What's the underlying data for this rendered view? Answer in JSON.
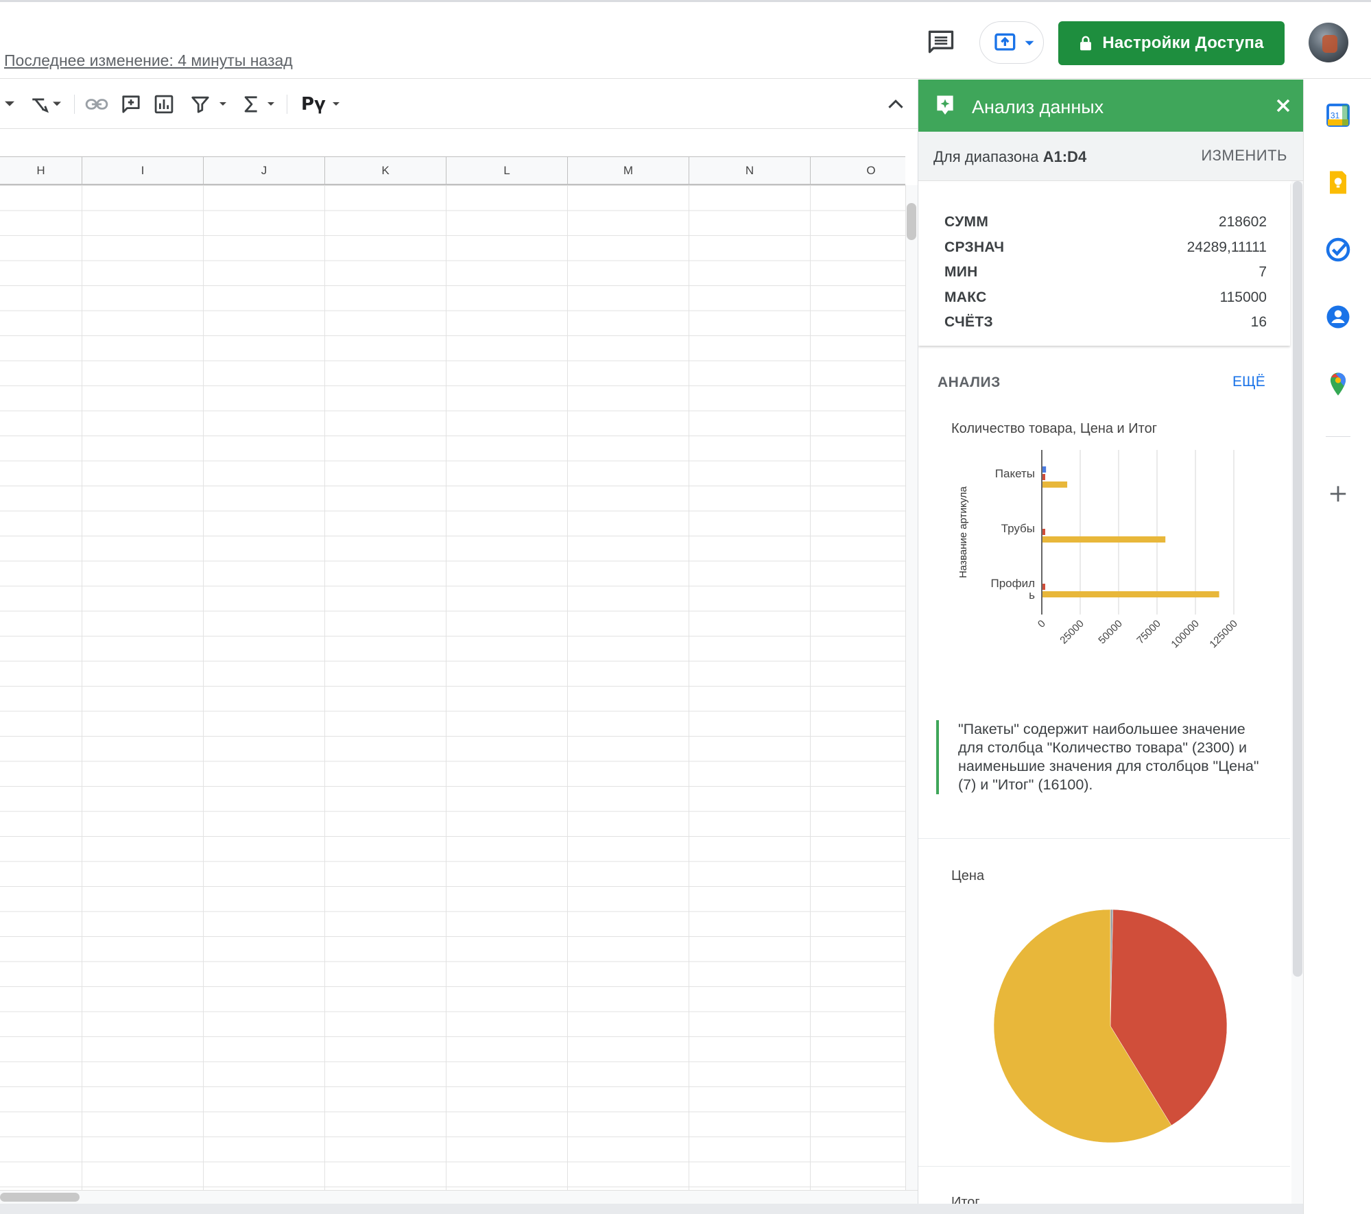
{
  "header": {
    "last_edit": "Последнее изменение: 4 минуты назад",
    "share_label": "Настройки Доступа"
  },
  "toolbar": {
    "script_label": "Рү"
  },
  "columns": [
    "H",
    "I",
    "J",
    "K",
    "L",
    "M",
    "N",
    "O"
  ],
  "panel": {
    "title": "Анализ данных",
    "range_prefix": "Для диапазона ",
    "range_value": "A1:D4",
    "change_label": "ИЗМЕНИТЬ",
    "stats": [
      {
        "name": "СУММ",
        "value": "218602"
      },
      {
        "name": "СРЗНАЧ",
        "value": "24289,11111"
      },
      {
        "name": "МИН",
        "value": "7"
      },
      {
        "name": "МАКС",
        "value": "115000"
      },
      {
        "name": "СЧЁТЗ",
        "value": "16"
      }
    ],
    "analysis_title": "АНАЛИЗ",
    "analysis_more": "ЕЩЁ",
    "insight": "\"Пакеты\" содержит наибольшее значение для столбца \"Количество товара\" (2300) и наименьшие значения для столбцов \"Цена\" (7) и \"Итог\" (16100).",
    "chart3_title": "Итог"
  },
  "colors": {
    "accent_green": "#3fa65a",
    "share_green": "#1e8e3e",
    "series_blue": "#4a7be0",
    "series_red": "#d04e3a",
    "series_yellow": "#e8b73a",
    "link_blue": "#1a73e8"
  },
  "chart_data": [
    {
      "type": "bar",
      "orientation": "horizontal",
      "title": "Количество товара, Цена и Итог",
      "ylabel": "Название артикула",
      "xlabel": "",
      "categories": [
        "Пакеты",
        "Трубы",
        "Профиль"
      ],
      "series": [
        {
          "values": [
            2300,
            0,
            0
          ],
          "color": "#4a7be0"
        },
        {
          "values": [
            7,
            800,
            1150
          ],
          "color": "#d04e3a"
        },
        {
          "values": [
            16100,
            80000,
            115000
          ],
          "color": "#e8b73a"
        }
      ],
      "xlim": [
        0,
        125000
      ],
      "x_ticks": [
        "0",
        "25000",
        "50000",
        "75000",
        "100000",
        "125000"
      ],
      "grid": true
    },
    {
      "type": "pie",
      "title": "Цена",
      "slices": [
        {
          "value": 7,
          "color": "#9aa0a6"
        },
        {
          "value": 800,
          "color": "#d04e3a"
        },
        {
          "value": 1150,
          "color": "#e8b73a"
        }
      ]
    }
  ]
}
